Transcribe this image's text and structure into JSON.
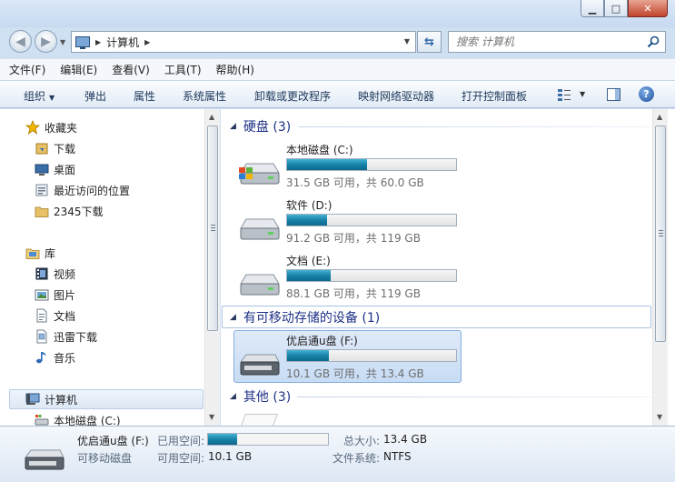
{
  "breadcrumb": {
    "root": "计算机"
  },
  "search": {
    "placeholder": "搜索 计算机"
  },
  "menu": [
    "文件(F)",
    "编辑(E)",
    "查看(V)",
    "工具(T)",
    "帮助(H)"
  ],
  "commands": {
    "organize": "组织",
    "eject": "弹出",
    "properties": "属性",
    "system_properties": "系统属性",
    "uninstall": "卸载或更改程序",
    "map_drive": "映射网络驱动器",
    "control_panel": "打开控制面板"
  },
  "nav": {
    "favorites": {
      "label": "收藏夹",
      "items": [
        "下载",
        "桌面",
        "最近访问的位置",
        "2345下载"
      ]
    },
    "libraries": {
      "label": "库",
      "items": [
        "视频",
        "图片",
        "文档",
        "迅雷下载",
        "音乐"
      ]
    },
    "computer": {
      "label": "计算机",
      "items": [
        "本地磁盘 (C:)"
      ]
    }
  },
  "groups": {
    "hdd": "硬盘 (3)",
    "removable": "有可移动存储的设备 (1)",
    "other": "其他 (3)"
  },
  "drives": [
    {
      "name": "本地磁盘 (C:)",
      "info": "31.5 GB 可用，共 60.0 GB",
      "used_fraction": 0.475
    },
    {
      "name": "软件 (D:)",
      "info": "91.2 GB 可用，共 119 GB",
      "used_fraction": 0.234
    },
    {
      "name": "文档 (E:)",
      "info": "88.1 GB 可用，共 119 GB",
      "used_fraction": 0.26
    }
  ],
  "removable_drives": [
    {
      "name": "优启通u盘 (F:)",
      "info": "10.1 GB 可用，共 13.4 GB",
      "used_fraction": 0.246
    }
  ],
  "details": {
    "name": "优启通u盘 (F:)",
    "type": "可移动磁盘",
    "used_label": "已用空间:",
    "free_label": "可用空间:",
    "free_value": "10.1 GB",
    "total_label": "总大小:",
    "total_value": "13.4 GB",
    "fs_label": "文件系统:",
    "fs_value": "NTFS",
    "used_fraction": 0.246
  }
}
